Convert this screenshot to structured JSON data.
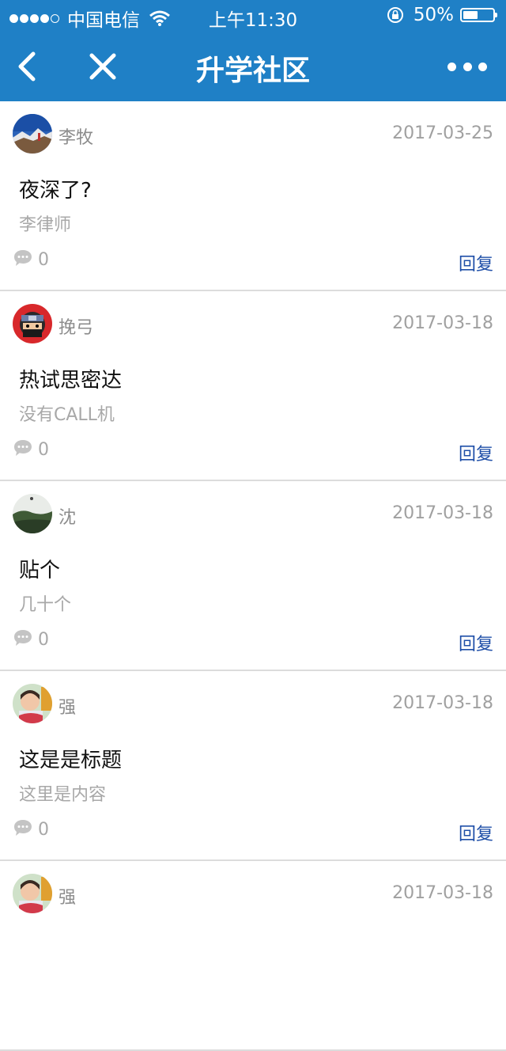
{
  "status_bar": {
    "carrier": "中国电信",
    "time": "上午11:30",
    "battery": "50%",
    "battery_level": 0.5,
    "signal_bars": 4
  },
  "nav": {
    "title": "升学社区",
    "accent_color": "#1f80c6"
  },
  "posts": [
    {
      "user": "李牧",
      "date": "2017-03-25",
      "title": "夜深了?",
      "content": "李律师",
      "comments": "0",
      "reply": "回复",
      "avatar": "mountain-avatar"
    },
    {
      "user": "挽弓",
      "date": "2017-03-18",
      "title": "热试思密达",
      "content": "没有CALL机",
      "comments": "0",
      "reply": "回复",
      "avatar": "ninja-avatar"
    },
    {
      "user": "沈",
      "date": "2017-03-18",
      "title": "贴个",
      "content": "几十个",
      "comments": "0",
      "reply": "回复",
      "avatar": "landscape-avatar"
    },
    {
      "user": "强",
      "date": "2017-03-18",
      "title": "这是是标题",
      "content": "这里是内容",
      "comments": "0",
      "reply": "回复",
      "avatar": "child-avatar"
    },
    {
      "user": "强",
      "date": "2017-03-18",
      "title": "",
      "content": "",
      "comments": "",
      "reply": "",
      "avatar": "child-avatar"
    }
  ]
}
